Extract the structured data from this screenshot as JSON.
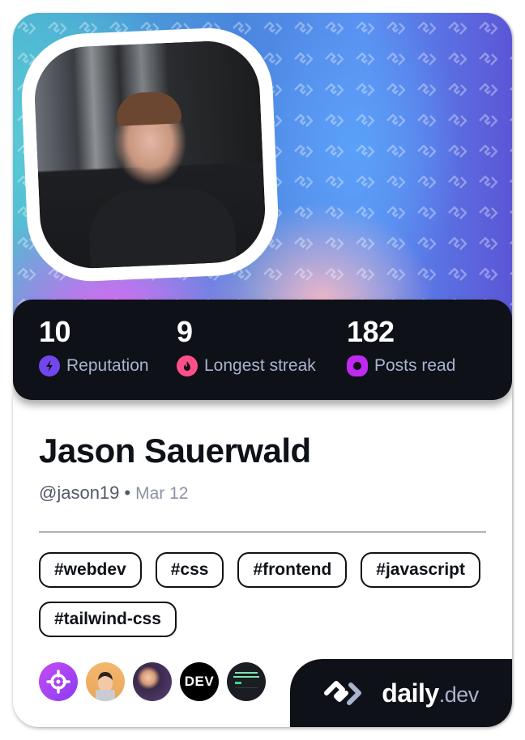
{
  "profile": {
    "name": "Jason Sauerwald",
    "handle": "@jason19",
    "separator": "•",
    "date": "Mar 12"
  },
  "stats": [
    {
      "value": "10",
      "label": "Reputation",
      "icon": "lightning-icon",
      "color": "#7147ed"
    },
    {
      "value": "9",
      "label": "Longest streak",
      "icon": "flame-icon",
      "color": "#ff4f8a"
    },
    {
      "value": "182",
      "label": "Posts read",
      "icon": "eye-icon",
      "color": "#c029f0"
    }
  ],
  "tags": [
    "#webdev",
    "#css",
    "#frontend",
    "#javascript",
    "#tailwind-css"
  ],
  "sources": [
    {
      "name": "crosshair-source",
      "icon": "crosshair-icon"
    },
    {
      "name": "devsquad-source",
      "icon": "memoji-avatar"
    },
    {
      "name": "person-source",
      "icon": "person-photo"
    },
    {
      "name": "dev-to-source",
      "label": "DEV"
    },
    {
      "name": "article-source",
      "icon": "article-thumbnail"
    }
  ],
  "brand": {
    "name": "daily",
    "tld": ".dev"
  },
  "colors": {
    "card_dark": "#0e1117",
    "label_gray": "#a8b3cf",
    "text_dark": "#0e1117"
  }
}
